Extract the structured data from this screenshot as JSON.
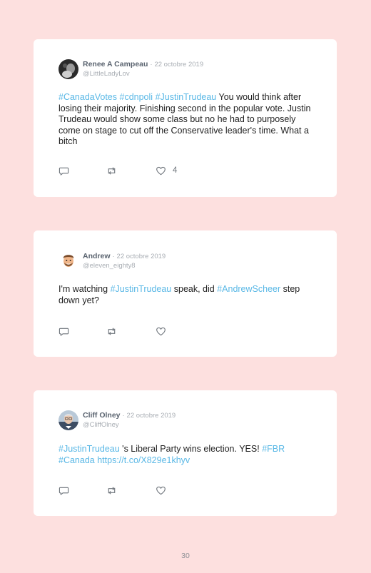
{
  "tweets": [
    {
      "author": "Renee A Campeau",
      "separator": "·",
      "date": "22 octobre 2019",
      "handle": "@LittleLadyLov",
      "text_segments": [
        {
          "text": "#CanadaVotes",
          "tag": true
        },
        {
          "text": " ",
          "tag": false
        },
        {
          "text": "#cdnpoli",
          "tag": true
        },
        {
          "text": " ",
          "tag": false
        },
        {
          "text": "#JustinTrudeau",
          "tag": true
        },
        {
          "text": " You would think after losing their majority. Finishing second in the popular vote. Justin Trudeau would show some class but no he had to purposely come on stage to cut off the Conservative leader's time. What a bitch",
          "tag": false
        }
      ],
      "like_count": "4",
      "avatar_icon": "avatar-dark-photo-icon"
    },
    {
      "author": "Andrew",
      "separator": "·",
      "date": "22 octobre 2019",
      "handle": "@eleven_eighty8",
      "text_segments": [
        {
          "text": "I'm watching ",
          "tag": false
        },
        {
          "text": "#JustinTrudeau",
          "tag": true
        },
        {
          "text": " speak, did ",
          "tag": false
        },
        {
          "text": "#AndrewScheer",
          "tag": true
        },
        {
          "text": " step down yet?",
          "tag": false
        }
      ],
      "like_count": "",
      "avatar_icon": "avatar-memoji-icon"
    },
    {
      "author": "Cliff Olney",
      "separator": "·",
      "date": "22 octobre 2019",
      "handle": "@CliffOlney",
      "text_segments": [
        {
          "text": "#JustinTrudeau",
          "tag": true
        },
        {
          "text": " 's Liberal Party wins election. YES! ",
          "tag": false
        },
        {
          "text": "#FBR",
          "tag": true
        },
        {
          "text": " ",
          "tag": false
        },
        {
          "text": "#Canada",
          "tag": true
        },
        {
          "text": " ",
          "tag": false
        },
        {
          "text": "https://t.co/X829e1khyv",
          "tag": true
        }
      ],
      "like_count": "",
      "avatar_icon": "avatar-photo-icon"
    }
  ],
  "page_number": "30",
  "colors": {
    "background": "#fde0df",
    "card": "#ffffff",
    "hashtag": "#5ab8e6",
    "author": "#5b6470",
    "meta": "#a9aeb4",
    "icon": "#6f757c"
  },
  "icons": {
    "reply": "reply-icon",
    "retweet": "retweet-icon",
    "like": "heart-icon"
  }
}
